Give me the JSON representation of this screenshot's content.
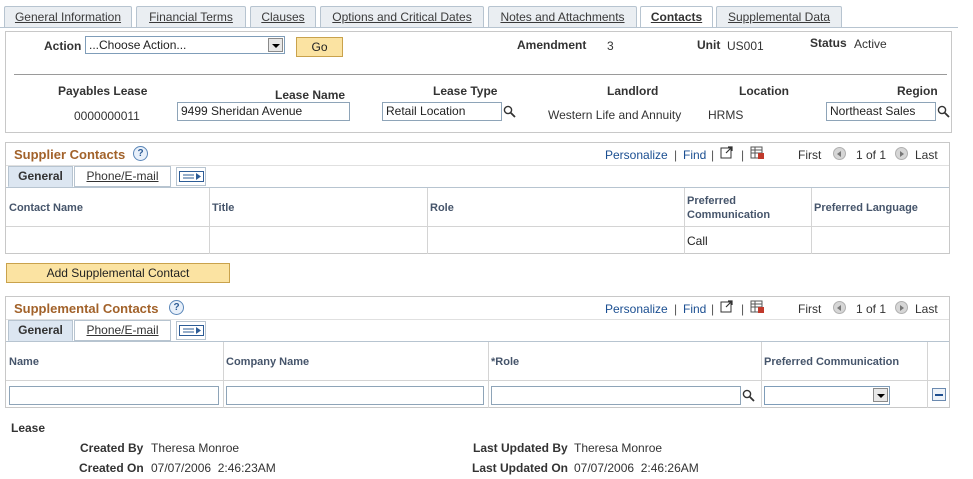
{
  "tabs": [
    {
      "label": "General Information"
    },
    {
      "label": "Financial Terms"
    },
    {
      "label": "Clauses"
    },
    {
      "label": "Options and Critical Dates"
    },
    {
      "label": "Notes and Attachments"
    },
    {
      "label": "Contacts"
    },
    {
      "label": "Supplemental Data"
    }
  ],
  "header": {
    "action_label": "Action",
    "action_value": "...Choose Action...",
    "go_label": "Go",
    "amendment_label": "Amendment",
    "amendment_value": "3",
    "unit_label": "Unit",
    "unit_value": "US001",
    "status_label": "Status",
    "status_value": "Active",
    "payables_lease_label": "Payables Lease",
    "payables_lease_value": "0000000011",
    "lease_name_label": "Lease Name",
    "lease_name_value": "9499 Sheridan Avenue",
    "lease_type_label": "Lease Type",
    "lease_type_value": "Retail Location",
    "landlord_label": "Landlord",
    "landlord_value": "Western Life and Annuity",
    "location_label": "Location",
    "location_value": "HRMS",
    "region_label": "Region",
    "region_value": "Northeast Sales"
  },
  "grid_nav": {
    "personalize": "Personalize",
    "pipe": "|",
    "find": "Find",
    "first": "First",
    "range": "1 of 1",
    "last": "Last"
  },
  "supplier_contacts": {
    "title": "Supplier Contacts",
    "help": "?",
    "subtabs": [
      "General",
      "Phone/E-mail"
    ],
    "columns": [
      "Contact Name",
      "Title",
      "Role",
      "Preferred Communication",
      "Preferred Language"
    ],
    "rows": [
      {
        "contact_name": "",
        "title": "",
        "role": "",
        "preferred_communication": "Call",
        "preferred_language": ""
      }
    ]
  },
  "add_supplemental_label": "Add Supplemental Contact",
  "supplemental_contacts": {
    "title": "Supplemental Contacts",
    "help": "?",
    "subtabs": [
      "General",
      "Phone/E-mail"
    ],
    "columns": [
      "Name",
      "Company Name",
      "*Role",
      "Preferred Communication"
    ],
    "rows": [
      {
        "name": "",
        "company_name": "",
        "role": "",
        "preferred_communication": ""
      }
    ]
  },
  "lease_footer": {
    "section_label": "Lease",
    "created_by_label": "Created By",
    "created_by_value": "Theresa Monroe",
    "created_on_label": "Created On",
    "created_on_value": "07/07/2006  2:46:23AM",
    "last_updated_by_label": "Last Updated By",
    "last_updated_by_value": "Theresa Monroe",
    "last_updated_on_label": "Last Updated On",
    "last_updated_on_value": "07/07/2006  2:46:26AM"
  },
  "colors": {
    "section_title": "#a2622a",
    "link": "#1a4e91",
    "button": "#fbe3a2",
    "active_subtab": "#dce6f1"
  }
}
